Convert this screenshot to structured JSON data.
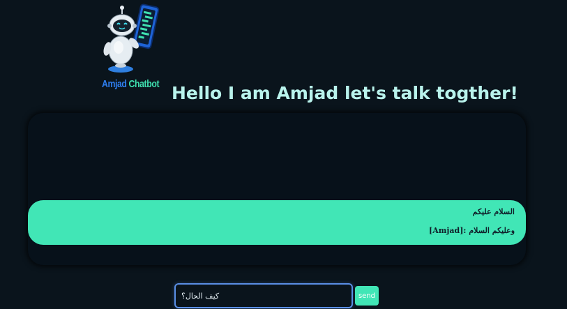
{
  "logo": {
    "word1": "Amjad",
    "word2": "Chatbot",
    "icon": "robot-holding-phone-icon"
  },
  "header": {
    "title": "Hello I am Amjad let's talk togther!"
  },
  "chat": {
    "messages": [
      {
        "user_text": "السلام عليكم",
        "reply_prefix": "[Amjad]:",
        "reply_text": "وعليكم السلام"
      }
    ]
  },
  "composer": {
    "input_value": "كيف الحال؟",
    "send_label": "send"
  },
  "colors": {
    "background": "#0a141c",
    "accent": "#41e6b6",
    "heading": "#b9f3ec",
    "input_border": "#5a8fe6"
  }
}
